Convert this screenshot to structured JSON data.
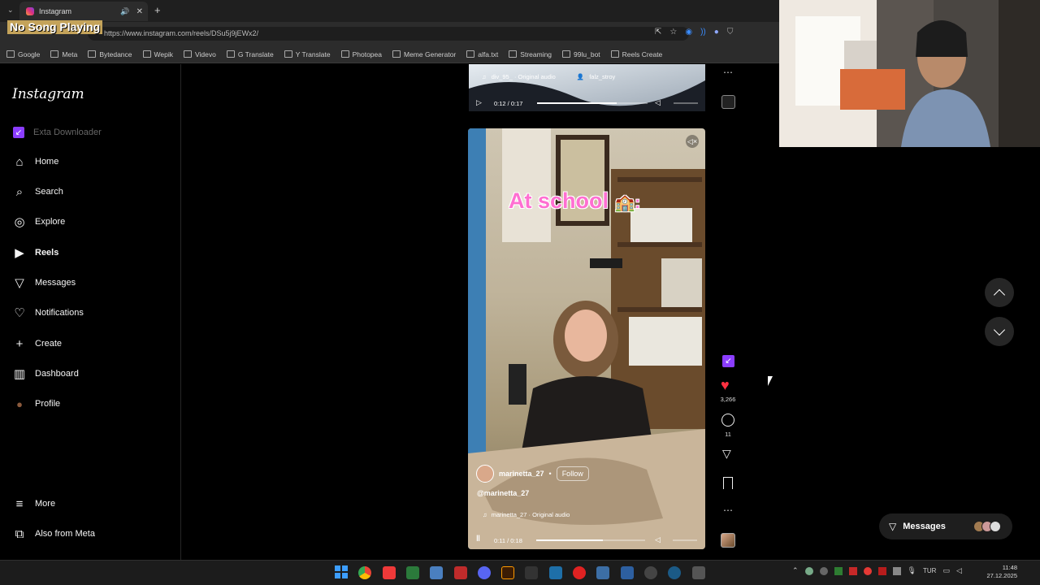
{
  "overlay": {
    "now_playing": "No Song Playing"
  },
  "browser": {
    "tab_title": "Instagram",
    "url": "https://www.instagram.com/reels/DSu5j9jEWx2/",
    "bookmarks": [
      "Google",
      "Meta",
      "Bytedance",
      "Wepik",
      "Videvo",
      "G Translate",
      "Y Translate",
      "Photopea",
      "Meme Generator",
      "alfa.txt",
      "Streaming",
      "99lu_bot",
      "Reels Create"
    ]
  },
  "sidebar": {
    "logo": "Instagram",
    "extension_label": "Exta Downloader",
    "items": [
      {
        "label": "Home",
        "icon": "home-icon"
      },
      {
        "label": "Search",
        "icon": "search-icon"
      },
      {
        "label": "Explore",
        "icon": "compass-icon"
      },
      {
        "label": "Reels",
        "icon": "reels-icon"
      },
      {
        "label": "Messages",
        "icon": "send-icon"
      },
      {
        "label": "Notifications",
        "icon": "heart-icon"
      },
      {
        "label": "Create",
        "icon": "plus-icon"
      },
      {
        "label": "Dashboard",
        "icon": "dashboard-icon"
      },
      {
        "label": "Profile",
        "icon": "avatar-icon"
      }
    ],
    "bottom_items": [
      {
        "label": "More",
        "icon": "menu-icon"
      },
      {
        "label": "Also from Meta",
        "icon": "meta-icon"
      }
    ]
  },
  "previous_reel": {
    "audio": "div_95_ · Original audio",
    "tagged_user": "falz_stroy",
    "time": "0:12 / 0:17",
    "progress": 0.72
  },
  "reel": {
    "caption_overlay": "At school",
    "username": "marinetta_27",
    "follow_label": "Follow",
    "handle": "@marinetta_27",
    "audio": "marinetta_27 · Original audio",
    "time": "0:11 / 0:18",
    "progress": 0.61,
    "likes": "3,266",
    "comments": "11"
  },
  "messages_button": {
    "label": "Messages"
  },
  "system_tray": {
    "language": "TUR",
    "time": "11:48",
    "date": "27.12.2025"
  },
  "colors": {
    "like": "#ff3040",
    "accent_purple": "#8b3dff",
    "overlay_gold": "#c4a35a",
    "caption_pink": "#ff6fd1"
  }
}
